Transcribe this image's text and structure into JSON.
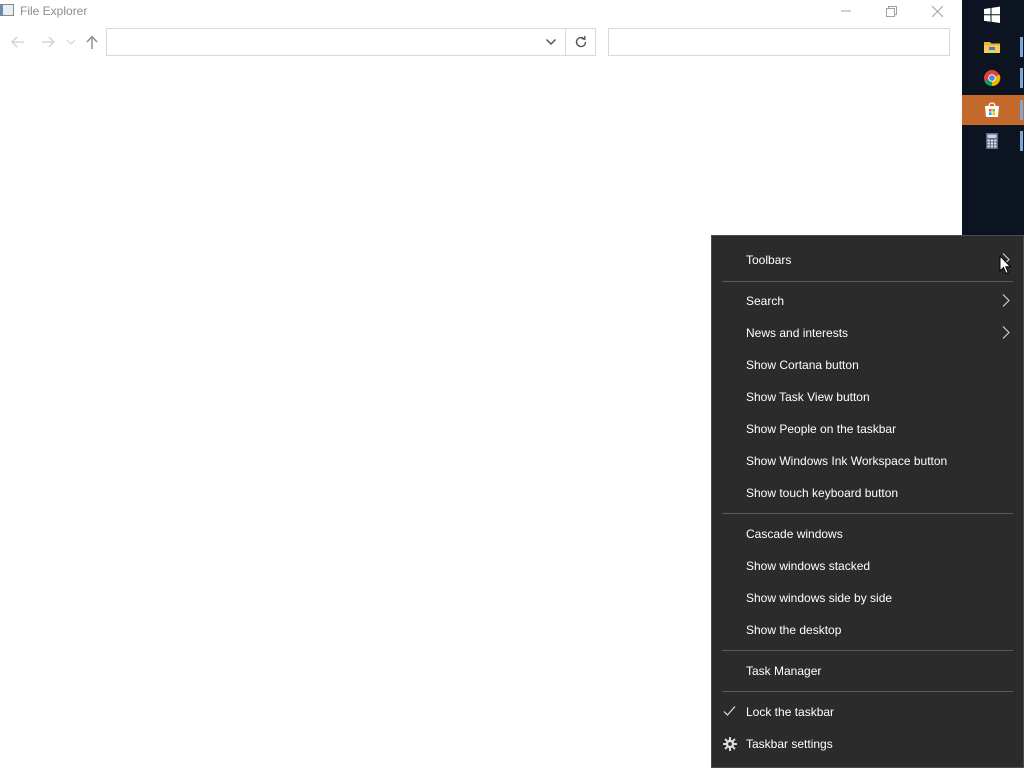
{
  "window": {
    "title": "File Explorer"
  },
  "address_bar": {
    "value": ""
  },
  "search_box": {
    "value": ""
  },
  "taskbar": {
    "items": [
      "start-icon",
      "file-explorer-icon",
      "chrome-icon",
      "store-icon",
      "calculator-icon"
    ],
    "active_color": "#c4692c",
    "background": "#0c1422"
  },
  "context_menu": {
    "toolbars": "Toolbars",
    "search": "Search",
    "news_and_interests": "News and interests",
    "show_cortana": "Show Cortana button",
    "show_task_view": "Show Task View button",
    "show_people": "Show People on the taskbar",
    "show_ink_workspace": "Show Windows Ink Workspace button",
    "show_touch_keyboard": "Show touch keyboard button",
    "cascade": "Cascade windows",
    "stacked": "Show windows stacked",
    "side_by_side": "Show windows side by side",
    "show_desktop": "Show the desktop",
    "task_manager": "Task Manager",
    "lock_taskbar": "Lock the taskbar",
    "taskbar_settings": "Taskbar settings"
  }
}
